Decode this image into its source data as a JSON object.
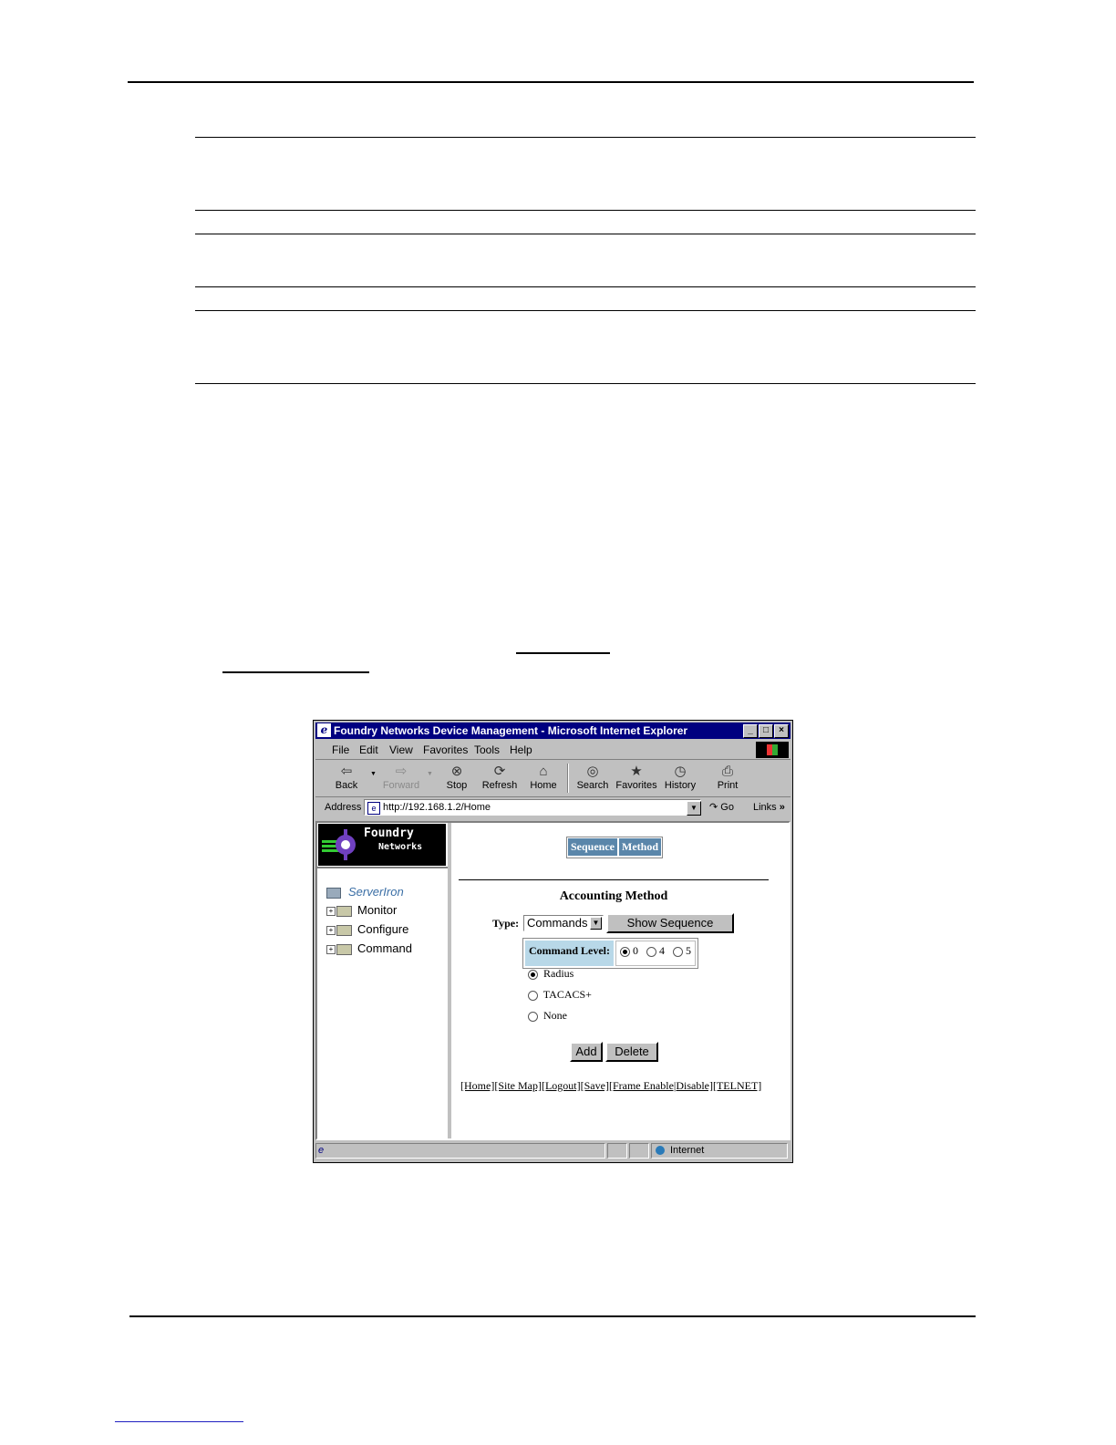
{
  "window": {
    "title": "Foundry Networks Device Management - Microsoft Internet Explorer",
    "controls": {
      "minimize": "_",
      "maximize": "□",
      "close": "×"
    }
  },
  "menu": [
    "File",
    "Edit",
    "View",
    "Favorites",
    "Tools",
    "Help"
  ],
  "toolbar": {
    "back": "Back",
    "forward": "Forward",
    "stop": "Stop",
    "refresh": "Refresh",
    "home": "Home",
    "search": "Search",
    "favorites": "Favorites",
    "history": "History",
    "print": "Print"
  },
  "address": {
    "label": "Address",
    "url": "http://192.168.1.2/Home",
    "go": "Go",
    "links": "Links"
  },
  "logo": {
    "line1": "Foundry",
    "line2": "Networks"
  },
  "tree": {
    "root": "ServerIron",
    "items": [
      "Monitor",
      "Configure",
      "Command"
    ]
  },
  "tabs": [
    "Sequence",
    "Method"
  ],
  "form": {
    "title": "Accounting Method",
    "type_label": "Type:",
    "type_value": "Commands",
    "show_sequence": "Show Sequence",
    "command_level_label": "Command Level:",
    "levels": [
      "0",
      "4",
      "5"
    ],
    "selected_level": "0",
    "methods": [
      "Radius",
      "TACACS+",
      "None"
    ],
    "selected_method": "Radius",
    "add": "Add",
    "delete": "Delete"
  },
  "footer_links": "[Home][Site Map][Logout][Save][Frame Enable|Disable][TELNET]",
  "status": {
    "zone": "Internet"
  }
}
